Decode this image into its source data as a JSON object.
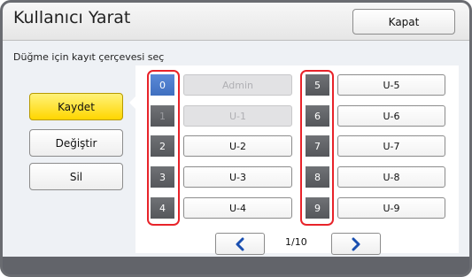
{
  "header": {
    "title": "Kullanıcı Yarat",
    "close_label": "Kapat"
  },
  "prompt": "Düğme için kayıt çerçevesi seç",
  "actions": {
    "save": "Kaydet",
    "change": "Değiştir",
    "delete": "Sil",
    "active": "save"
  },
  "slots_left": [
    {
      "num": "0",
      "name": "Admin",
      "disabled": true,
      "selected": true
    },
    {
      "num": "1",
      "name": "U-1",
      "disabled": true
    },
    {
      "num": "2",
      "name": "U-2"
    },
    {
      "num": "3",
      "name": "U-3"
    },
    {
      "num": "4",
      "name": "U-4"
    }
  ],
  "slots_right": [
    {
      "num": "5",
      "name": "U-5"
    },
    {
      "num": "6",
      "name": "U-6"
    },
    {
      "num": "7",
      "name": "U-7"
    },
    {
      "num": "8",
      "name": "U-8"
    },
    {
      "num": "9",
      "name": "U-9"
    }
  ],
  "pager": {
    "text": "1/10",
    "prev_icon": "chevron-left-icon",
    "next_icon": "chevron-right-icon"
  },
  "colors": {
    "accent_blue": "#1a4fb0",
    "highlight_red": "#e8232a",
    "active_yellow": "#ffd600",
    "selected_blue": "#4f7fd0"
  }
}
